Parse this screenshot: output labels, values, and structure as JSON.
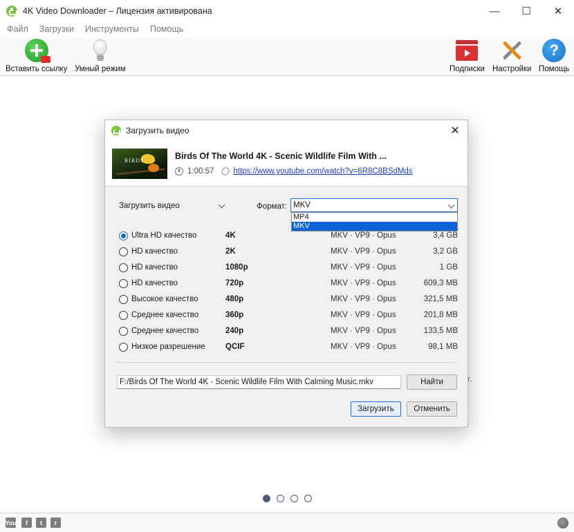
{
  "window": {
    "title": "4K Video Downloader – Лицензия активирована"
  },
  "menu": [
    "Файл",
    "Загрузки",
    "Инструменты",
    "Помощь"
  ],
  "toolbar": {
    "paste_link": "Вставить ссылку",
    "smart_mode": "Умный режим",
    "subscriptions": "Подписки",
    "settings": "Настройки",
    "help": "Помощь"
  },
  "dialog": {
    "title": "Загрузить видео",
    "video": {
      "title": "Birds Of The World 4K - Scenic Wildlife Film With ...",
      "duration": "1:00:57",
      "url": "https://www.youtube.com/watch?v=6R8C8BSdMds",
      "thumb_text": "BIRDS"
    },
    "mode_select": "Загрузить видео",
    "format_label": "Формат:",
    "format_value": "MKV",
    "format_options": [
      "MP4",
      "MKV"
    ],
    "qualities": [
      {
        "name": "Ultra HD качество",
        "res": "4K",
        "codec": "MKV · VP9 · Opus",
        "size": "3,4 GB",
        "selected": true
      },
      {
        "name": "HD качество",
        "res": "2K",
        "codec": "MKV · VP9 · Opus",
        "size": "3,2 GB",
        "selected": false
      },
      {
        "name": "HD качество",
        "res": "1080p",
        "codec": "MKV · VP9 · Opus",
        "size": "1 GB",
        "selected": false
      },
      {
        "name": "HD качество",
        "res": "720p",
        "codec": "MKV · VP9 · Opus",
        "size": "609,3 MB",
        "selected": false
      },
      {
        "name": "Высокое качество",
        "res": "480p",
        "codec": "MKV · VP9 · Opus",
        "size": "321,5 MB",
        "selected": false
      },
      {
        "name": "Среднее качество",
        "res": "360p",
        "codec": "MKV · VP9 · Opus",
        "size": "201,8 MB",
        "selected": false
      },
      {
        "name": "Среднее качество",
        "res": "240p",
        "codec": "MKV · VP9 · Opus",
        "size": "133,5 MB",
        "selected": false
      },
      {
        "name": "Низкое разрешение",
        "res": "QCIF",
        "codec": "MKV · VP9 · Opus",
        "size": "98,1 MB",
        "selected": false
      }
    ],
    "path": "F:/Birds Of The World 4K - Scenic Wildlife Film With Calming Music.mkv",
    "browse": "Найти",
    "download": "Загрузить",
    "cancel": "Отменить"
  },
  "pager": {
    "pages": 4,
    "active": 0
  },
  "statusbar": {
    "youtube_label": "You"
  },
  "colors": {
    "accent": "#1e6fd9",
    "brand_green": "#7cc243",
    "link": "#1a3fc4"
  }
}
